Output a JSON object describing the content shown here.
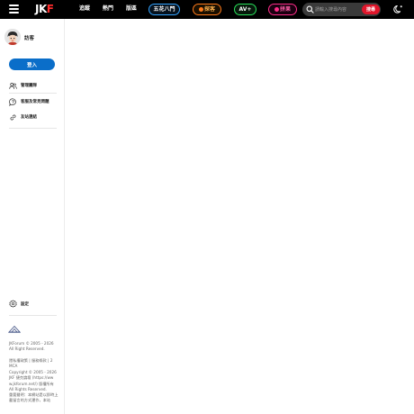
{
  "header": {
    "logo_main": "JK",
    "logo_accent": "F",
    "nav": [
      "追蹤",
      "熱門",
      "版區"
    ],
    "pills": {
      "wuhua": "五花八門",
      "tanke": "探客",
      "avplus": "AV+",
      "pinguo": "拼果"
    },
    "search_placeholder": "請輸入搜尋內容",
    "search_button": "搜尋"
  },
  "sidebar": {
    "username": "訪客",
    "login_label": "登入",
    "menu": [
      {
        "label": "管理團隊",
        "icon": "users-icon"
      },
      {
        "label": "客服及常見問題",
        "icon": "help-chat-icon"
      },
      {
        "label": "友站連結",
        "icon": "link-icon"
      }
    ],
    "settings_label": "設定",
    "footer": {
      "copyright_1": "JKForum © 2005 - 2026 All Right Reserved.",
      "policy": "隱私權政策 | 服務條款 | 2 MCA",
      "copyright_2": "Copyright © 2005 - 2026 JKF 捷克論壇 (https://ww w.jkforum.net/) 版權所有 All Rights Reserved.",
      "notice": "重要聲明：本網站是以即時上載留言的方式運作，本站"
    }
  },
  "colors": {
    "topbar": "#000000",
    "accent_blue": "#0a6ec9",
    "search_red": "#e0162b",
    "logo_red": "#ff2d2d"
  }
}
